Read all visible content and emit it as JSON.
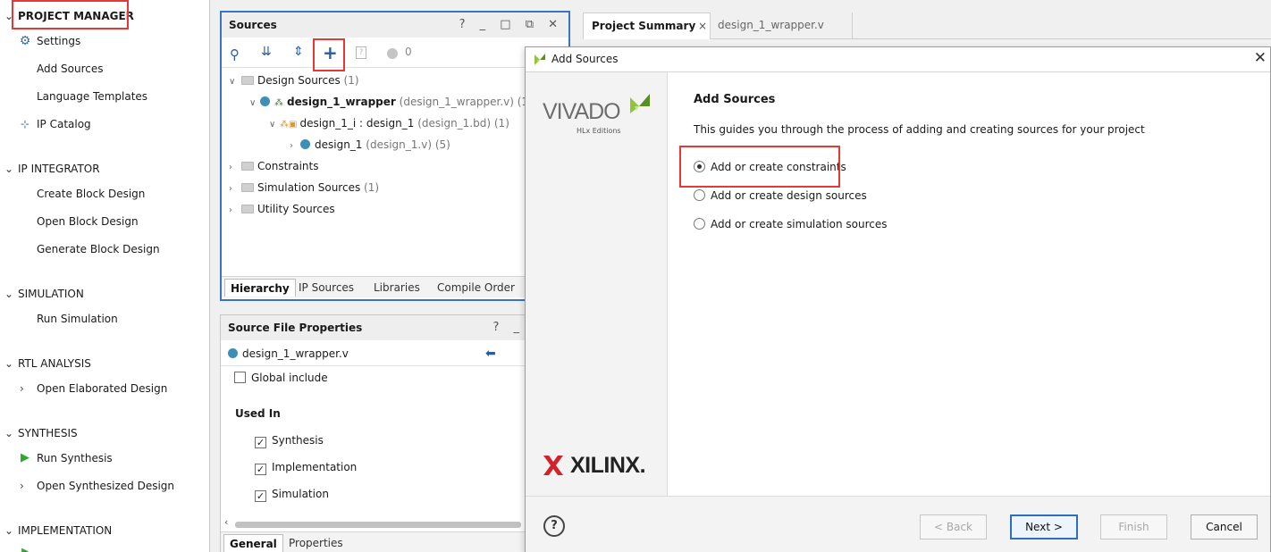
{
  "flow_navigator": {
    "sections": [
      {
        "label": "PROJECT MANAGER",
        "items": [
          {
            "label": "Settings",
            "icon": "gear-icon"
          },
          {
            "label": "Add Sources"
          },
          {
            "label": "Language Templates"
          },
          {
            "label": "IP Catalog",
            "icon": "ip-catalog-icon"
          }
        ]
      },
      {
        "label": "IP INTEGRATOR",
        "items": [
          {
            "label": "Create Block Design"
          },
          {
            "label": "Open Block Design"
          },
          {
            "label": "Generate Block Design"
          }
        ]
      },
      {
        "label": "SIMULATION",
        "items": [
          {
            "label": "Run Simulation"
          }
        ]
      },
      {
        "label": "RTL ANALYSIS",
        "items": [
          {
            "label": "Open Elaborated Design"
          }
        ]
      },
      {
        "label": "SYNTHESIS",
        "items": [
          {
            "label": "Run Synthesis",
            "icon": "run-icon"
          },
          {
            "label": "Open Synthesized Design"
          }
        ]
      },
      {
        "label": "IMPLEMENTATION",
        "items": []
      }
    ]
  },
  "sources_panel": {
    "title": "Sources",
    "window_buttons": "? _ □ ⧉ ✕",
    "toolbar": {
      "badge_count": "0"
    },
    "tree": {
      "design_sources": {
        "label": "Design Sources",
        "count": "(1)"
      },
      "wrapper": {
        "name": "design_1_wrapper",
        "file": "(design_1_wrapper.v)",
        "count": "(1)"
      },
      "design_1_i": {
        "name": "design_1_i : design_1",
        "file": "(design_1.bd)",
        "count": "(1)"
      },
      "design_1": {
        "name": "design_1",
        "file": "(design_1.v)",
        "count": "(5)"
      },
      "constraints": {
        "label": "Constraints"
      },
      "simulation_sources": {
        "label": "Simulation Sources",
        "count": "(1)"
      },
      "utility_sources": {
        "label": "Utility Sources"
      }
    },
    "tabs": [
      "Hierarchy",
      "IP Sources",
      "Libraries",
      "Compile Order"
    ]
  },
  "source_file_properties": {
    "title": "Source File Properties",
    "window_buttons": "? _",
    "file_name": "design_1_wrapper.v",
    "global_include": "Global include",
    "used_in_label": "Used In",
    "used_in": [
      {
        "label": "Synthesis",
        "checked": true
      },
      {
        "label": "Implementation",
        "checked": true
      },
      {
        "label": "Simulation",
        "checked": true
      }
    ],
    "tabs": [
      "General",
      "Properties"
    ]
  },
  "editor_tabs": [
    {
      "label": "Project Summary",
      "active": true
    },
    {
      "label": "design_1_wrapper.v",
      "active": false
    }
  ],
  "dialog": {
    "title": "Add Sources",
    "vivado_logo": "VIVADO",
    "vivado_sub": "HLx Editions",
    "xilinx_logo": "XILINX.",
    "heading": "Add Sources",
    "description": "This guides you through the process of adding and creating sources for your project",
    "options": [
      {
        "label": "Add or create constraints",
        "selected": true
      },
      {
        "label": "Add or create design sources",
        "selected": false
      },
      {
        "label": "Add or create simulation sources",
        "selected": false
      }
    ],
    "buttons": {
      "back": "< Back",
      "next": "Next >",
      "finish": "Finish",
      "cancel": "Cancel"
    }
  },
  "colors": {
    "highlight_red": "#e53935",
    "accent_blue": "#2f6fb7",
    "vivado_green": "#8cc63f",
    "xilinx_red": "#d2232a"
  }
}
